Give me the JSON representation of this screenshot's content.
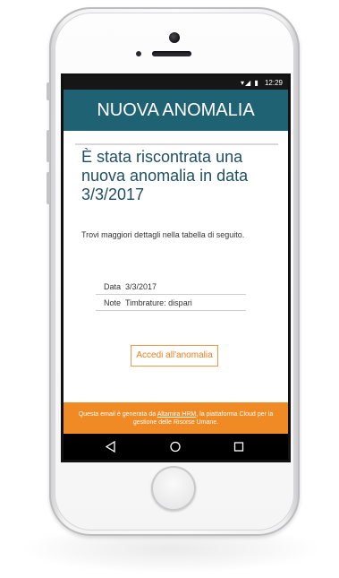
{
  "status_bar": {
    "time": "12:29",
    "signal_icons": "▾◢ ▮"
  },
  "email": {
    "header_title": "NUOVA ANOMALIA",
    "title": "È stata riscontrata una nuova anomalia in data 3/3/2017",
    "intro": "Trovi maggiori dettagli nella tabella di seguito.",
    "details": [
      {
        "label": "Data",
        "value": "3/3/2017"
      },
      {
        "label": "Note",
        "value": "Timbrature: dispari"
      }
    ],
    "cta_label": "Accedi all'anomalia",
    "footer_prefix": "Questa email è generata da ",
    "footer_link": "Altamira HRM",
    "footer_suffix": ", la piattaforma Cloud per la gestione delle Risorse Umane."
  },
  "colors": {
    "header_bg": "#1f6274",
    "title_text": "#1f4f63",
    "accent_orange": "#f08a24",
    "cta_text": "#ee7d1e"
  },
  "icons": {
    "nav_back": "back-triangle-icon",
    "nav_home": "home-circle-icon",
    "nav_recent": "recent-square-icon"
  }
}
